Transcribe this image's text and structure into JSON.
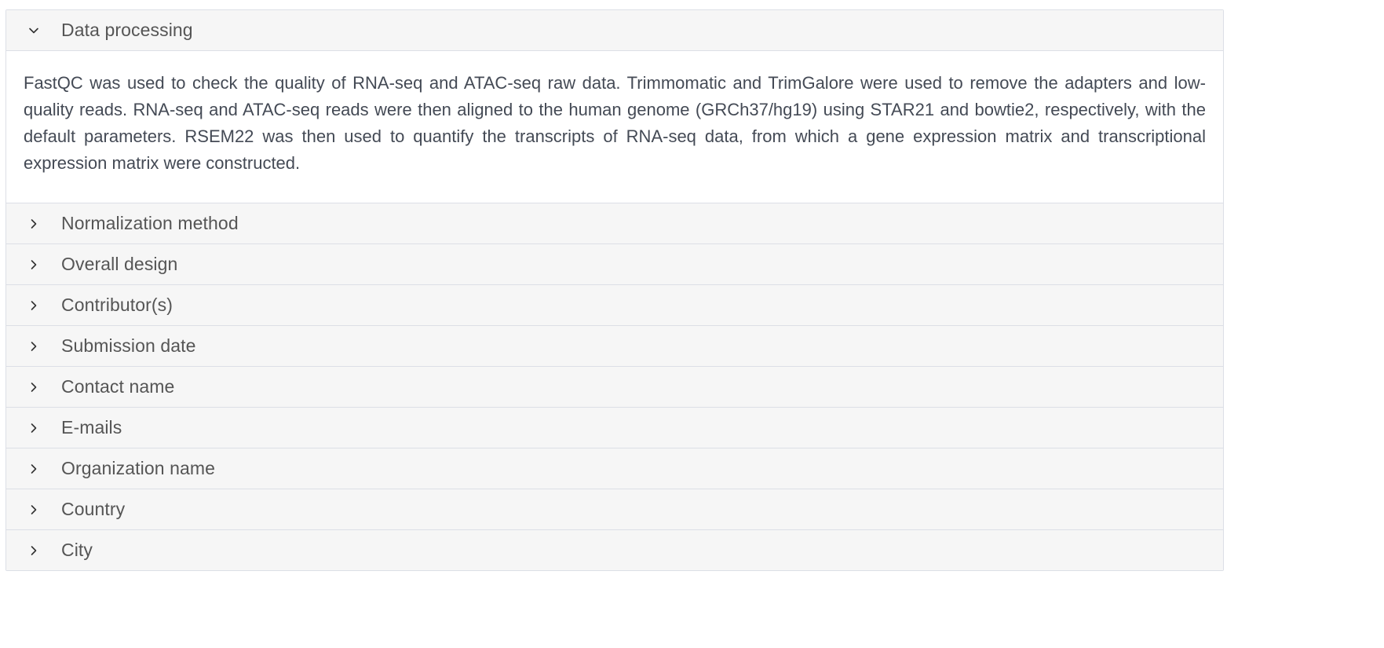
{
  "panels": [
    {
      "title": "Data processing",
      "expanded": true,
      "icon": "chevron-down-icon",
      "body": "FastQC was used to check the quality of RNA-seq and ATAC-seq raw data. Trimmomatic and TrimGalore were used to remove the adapters and low-quality reads. RNA-seq and ATAC-seq reads were then aligned to the human genome (GRCh37/hg19) using STAR21 and bowtie2, respectively, with the default parameters. RSEM22 was then used to quantify the transcripts of RNA-seq data, from which a gene expression matrix and transcriptional expression matrix were constructed."
    },
    {
      "title": "Normalization method",
      "expanded": false,
      "icon": "chevron-right-icon"
    },
    {
      "title": "Overall design",
      "expanded": false,
      "icon": "chevron-right-icon"
    },
    {
      "title": "Contributor(s)",
      "expanded": false,
      "icon": "chevron-right-icon"
    },
    {
      "title": "Submission date",
      "expanded": false,
      "icon": "chevron-right-icon"
    },
    {
      "title": "Contact name",
      "expanded": false,
      "icon": "chevron-right-icon"
    },
    {
      "title": "E-mails",
      "expanded": false,
      "icon": "chevron-right-icon"
    },
    {
      "title": "Organization name",
      "expanded": false,
      "icon": "chevron-right-icon"
    },
    {
      "title": "Country",
      "expanded": false,
      "icon": "chevron-right-icon"
    },
    {
      "title": "City",
      "expanded": false,
      "icon": "chevron-right-icon"
    }
  ],
  "colors": {
    "header_bg": "#f6f6f6",
    "border": "#dcdfe6",
    "title_text": "#555555",
    "body_text": "#444a55"
  }
}
